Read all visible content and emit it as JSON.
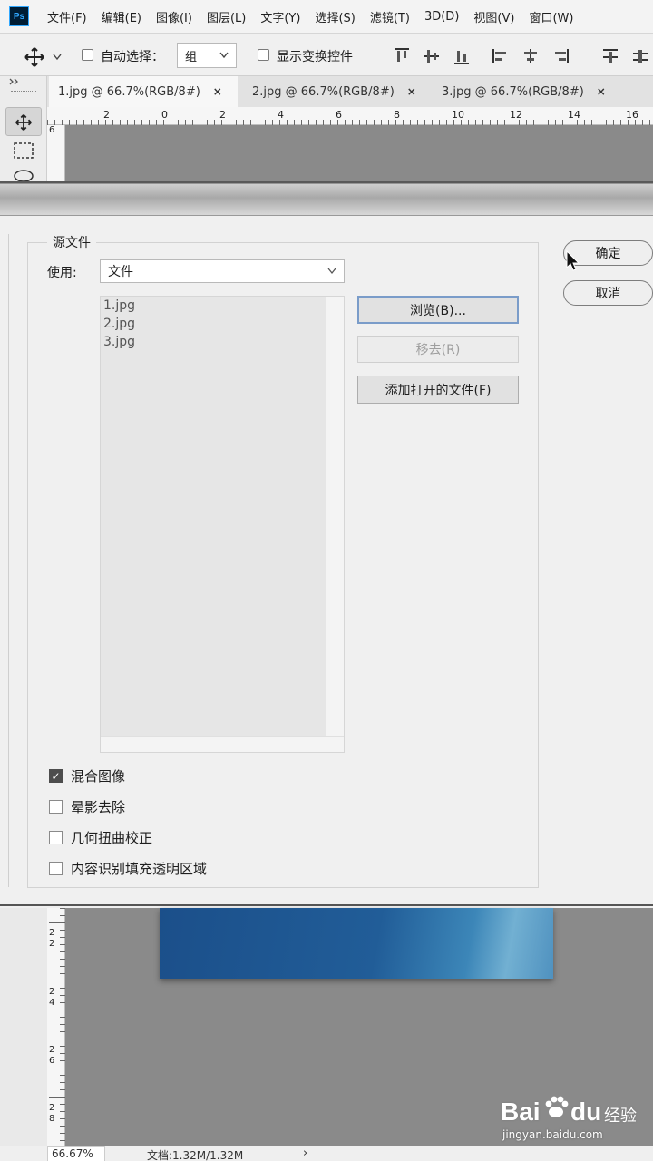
{
  "app": {
    "logo_text": "Ps"
  },
  "menu": [
    "文件(F)",
    "编辑(E)",
    "图像(I)",
    "图层(L)",
    "文字(Y)",
    "选择(S)",
    "滤镜(T)",
    "3D(D)",
    "视图(V)",
    "窗口(W)"
  ],
  "options_bar": {
    "auto_select_label": "自动选择：",
    "auto_select_value": "组",
    "show_transform_label": "显示变换控件"
  },
  "tabs": [
    {
      "label": "1.jpg @ 66.7%(RGB/8#)",
      "close": "×"
    },
    {
      "label": "2.jpg @ 66.7%(RGB/8#)",
      "close": "×"
    },
    {
      "label": "3.jpg @ 66.7%(RGB/8#)",
      "close": "×"
    }
  ],
  "ruler_top_labels": [
    "2",
    "0",
    "2",
    "4",
    "6",
    "8",
    "10",
    "12",
    "14",
    "16"
  ],
  "ruler_left_top_labels": [
    "6"
  ],
  "ruler_left_bottom_labels": [
    "2",
    "2",
    "2",
    "4",
    "2",
    "6",
    "2",
    "8"
  ],
  "dialog": {
    "group_title": "源文件",
    "use_label": "使用:",
    "use_value": "文件",
    "files": [
      "1.jpg",
      "2.jpg",
      "3.jpg"
    ],
    "browse_label": "浏览(B)...",
    "remove_label": "移去(R)",
    "add_open_label": "添加打开的文件(F)",
    "ok_label": "确定",
    "cancel_label": "取消",
    "options": [
      {
        "label": "混合图像",
        "checked": true
      },
      {
        "label": "晕影去除",
        "checked": false
      },
      {
        "label": "几何扭曲校正",
        "checked": false
      },
      {
        "label": "内容识别填充透明区域",
        "checked": false
      }
    ]
  },
  "statusbar": {
    "zoom": "66.67%",
    "doc_info": "文档:1.32M/1.32M",
    "arrow": "›"
  },
  "watermark": {
    "brand": "Bai",
    "brand2": "du",
    "sub": "经验",
    "url": "jingyan.baidu.com"
  }
}
